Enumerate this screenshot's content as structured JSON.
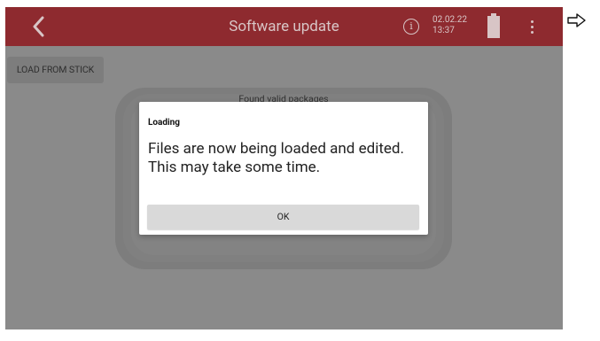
{
  "header": {
    "title": "Software update",
    "date": "02.02.22",
    "time": "13:37",
    "info_symbol": "i",
    "back_icon": "chevron-left-icon",
    "battery_icon": "battery-full-icon",
    "menu_icon": "more-vertical-icon"
  },
  "toolbar": {
    "load_from_stick_label": "LOAD FROM STICK"
  },
  "packages_panel": {
    "label": "Found valid packages"
  },
  "dialog": {
    "title": "Loading",
    "message": "Files are now being loaded and edited. This may take some time.",
    "ok_label": "OK"
  },
  "side": {
    "arrow_icon": "arrow-right-outline-icon"
  },
  "colors": {
    "topbar": "#8e2a2f",
    "screen_overlay": "#8a8a8a",
    "dialog_background": "#ffffff",
    "ok_button": "#d9d9d9"
  }
}
